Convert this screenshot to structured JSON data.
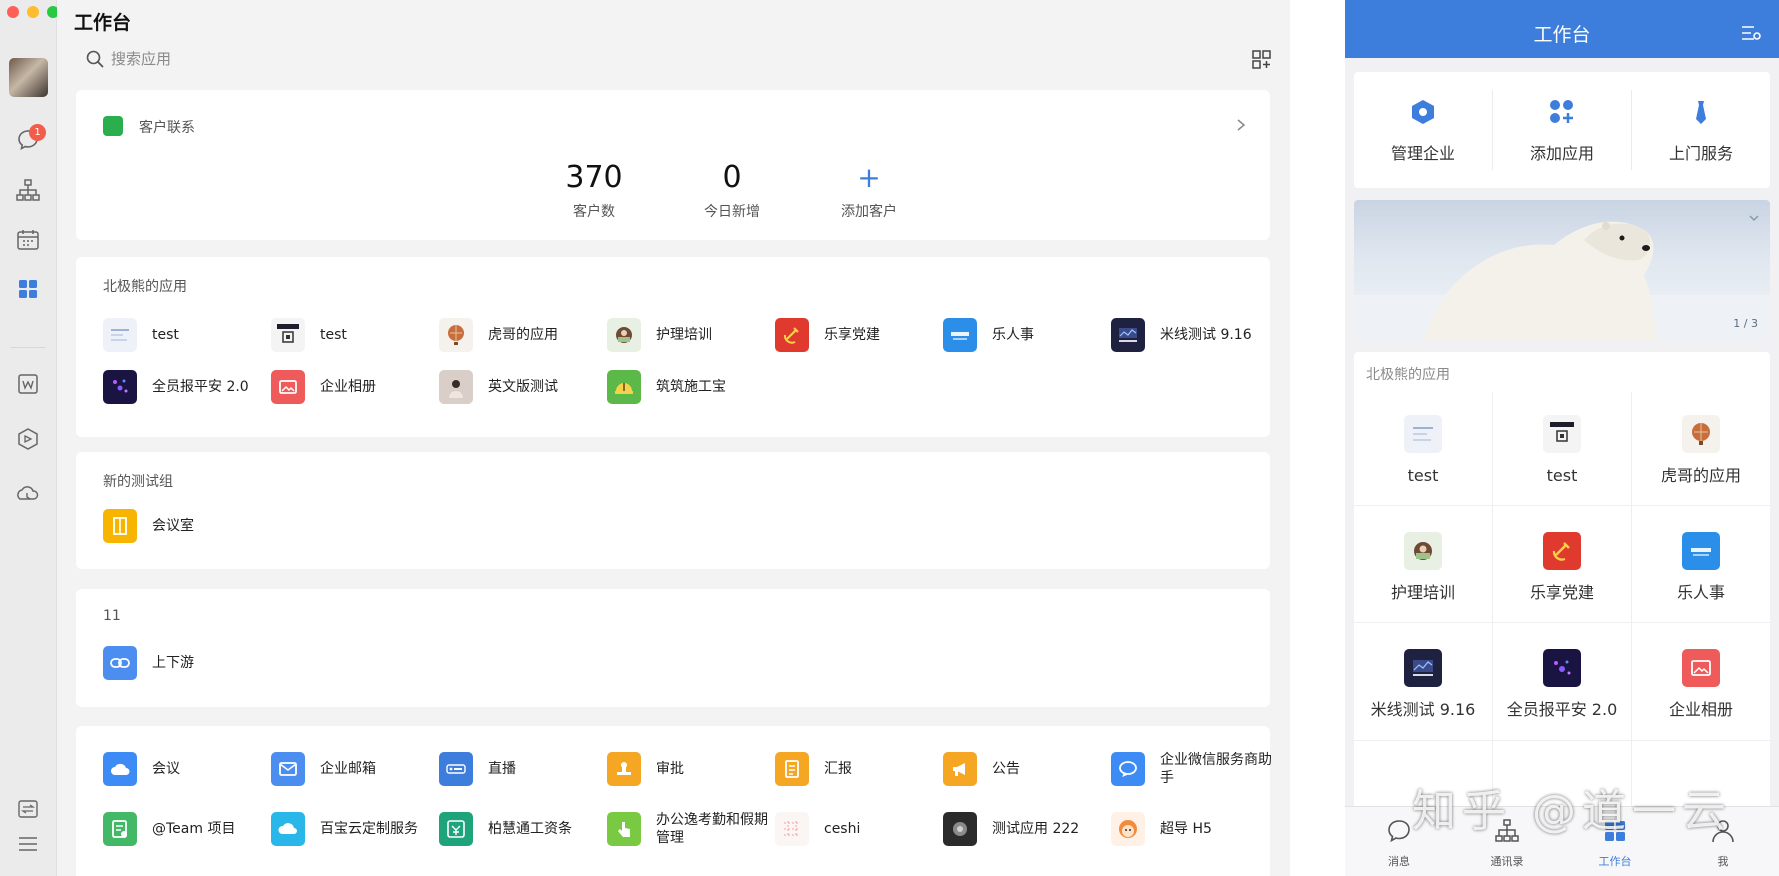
{
  "desktop": {
    "title": "工作台",
    "search_placeholder": "搜索应用",
    "badge_count": "1",
    "customer": {
      "title": "客户联系",
      "stats": [
        {
          "value": "370",
          "label": "客户数"
        },
        {
          "value": "0",
          "label": "今日新增"
        }
      ],
      "add_symbol": "+",
      "add_label": "添加客户"
    },
    "group1": {
      "title": "北极熊的应用",
      "apps": [
        "test",
        "test",
        "虎哥的应用",
        "护理培训",
        "乐享党建",
        "乐人事",
        "米线测试 9.16",
        "全员报平安 2.0",
        "企业相册",
        "英文版测试",
        "筑筑施工宝"
      ]
    },
    "group2": {
      "title": "新的测试组",
      "apps": [
        "会议室"
      ]
    },
    "group3": {
      "title": "11",
      "apps": [
        "上下游"
      ]
    },
    "group4": {
      "apps": [
        "会议",
        "企业邮箱",
        "直播",
        "审批",
        "汇报",
        "公告",
        "企业微信服务商助手",
        "@Team 项目",
        "百宝云定制服务",
        "柏慧通工资条",
        "办公逸考勤和假期管理",
        "ceshi",
        "测试应用 222",
        "超导 H5"
      ]
    }
  },
  "mobile": {
    "title": "工作台",
    "quick": [
      "管理企业",
      "添加应用",
      "上门服务"
    ],
    "banner_pager": "1 / 3",
    "apps_title": "北极熊的应用",
    "apps": [
      "test",
      "test",
      "虎哥的应用",
      "护理培训",
      "乐享党建",
      "乐人事",
      "米线测试 9.16",
      "全员报平安 2.0",
      "企业相册"
    ],
    "tabs": [
      "消息",
      "通讯录",
      "工作台",
      "我"
    ],
    "watermark": "知乎 @道一云"
  },
  "colors": {
    "accent": "#3d7ddb",
    "badge": "#f25c4a",
    "wechat_green": "#2bae4d"
  }
}
